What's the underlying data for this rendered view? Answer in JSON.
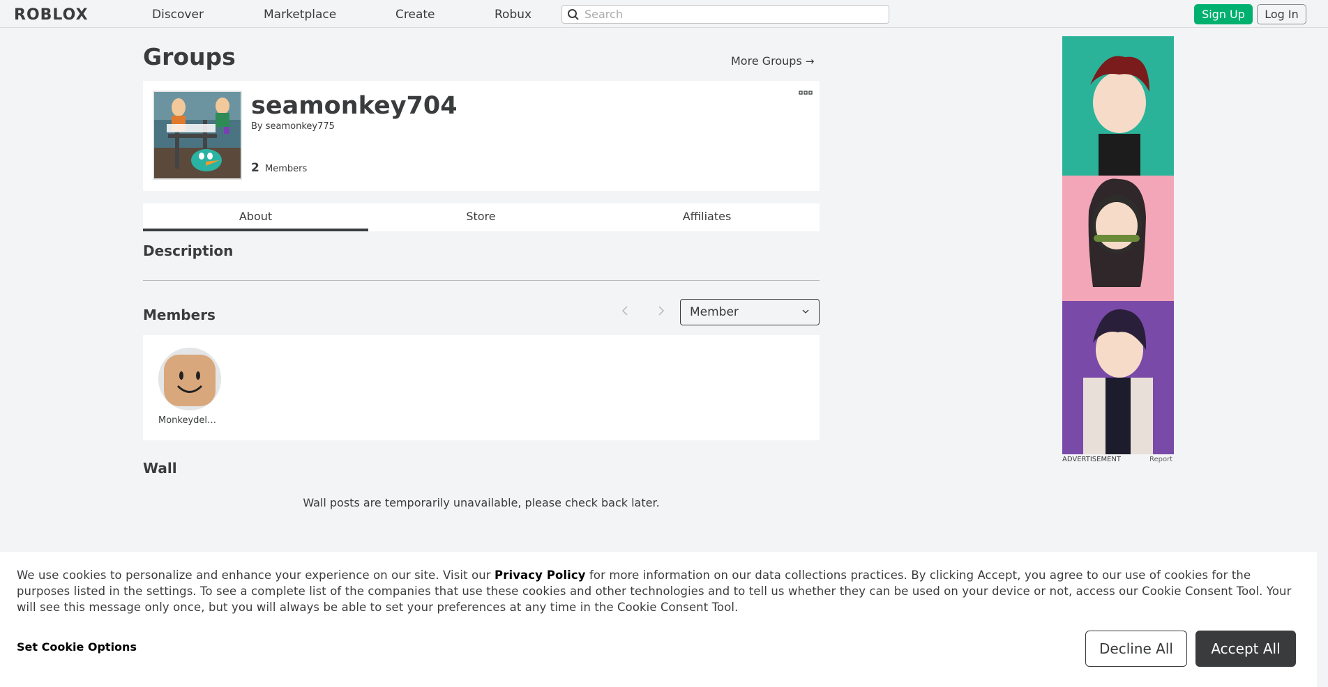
{
  "nav": {
    "logo": "ROBLOX",
    "links": [
      "Discover",
      "Marketplace",
      "Create",
      "Robux"
    ],
    "search_placeholder": "Search",
    "signup": "Sign Up",
    "login": "Log In"
  },
  "page": {
    "title": "Groups",
    "more_groups": "More Groups",
    "more_groups_arrow": "→"
  },
  "group": {
    "name": "seamonkey704",
    "by_label": "By",
    "owner": "seamonkey775",
    "member_count": "2",
    "members_label": "Members"
  },
  "tabs": [
    "About",
    "Store",
    "Affiliates"
  ],
  "sections": {
    "description": "Description",
    "members": "Members",
    "wall": "Wall"
  },
  "members": {
    "role_select": "Member",
    "list": [
      {
        "name": "Monkeydelu..."
      }
    ]
  },
  "wall": {
    "message": "Wall posts are temporarily unavailable, please check back later."
  },
  "ad": {
    "label": "ADVERTISEMENT",
    "report": "Report"
  },
  "cookie": {
    "text_before": "We use cookies to personalize and enhance your experience on our site. Visit our ",
    "privacy_link": "Privacy Policy",
    "text_after": " for more information on our data collections practices. By clicking Accept, you agree to our use of cookies for the purposes listed in the settings. To see a complete list of the companies that use these cookies and other technologies and to tell us whether they can be used on your device or not, access our Cookie Consent Tool. Your will see this message only once, but you will always be able to set your preferences at any time in the Cookie Consent Tool.",
    "options": "Set Cookie Options",
    "decline": "Decline All",
    "accept": "Accept All"
  },
  "colors": {
    "signup_green": "#00b06f",
    "accept_dark": "#393b3d",
    "page_bg": "#f2f4f5"
  }
}
